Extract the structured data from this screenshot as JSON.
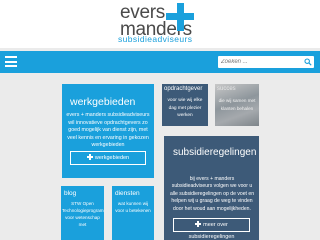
{
  "header": {
    "logo_line1": "evers",
    "logo_line2": "manders",
    "tagline": "subsidieadviseurs"
  },
  "nav": {
    "menu_icon": "hamburger-icon",
    "search_placeholder": "Zoeken ...",
    "search_icon": "search-icon"
  },
  "tiles": {
    "werkgebieden": {
      "title": "werkgebieden",
      "body": "evers + manders subsidieadviseurs wil innovatieve opdrachtgevers zo goed mogelijk van dienst zijn, met veel kennis en ervaring in gekozen werkgebieden",
      "button": "werkgebieden"
    },
    "opdrachtgever": {
      "title": "opdrachtgever",
      "body": "voor wie wij elke dag met plezier werken"
    },
    "photo": {
      "title": "succes",
      "body": "die wij samen met klanten behalen"
    },
    "subsidie": {
      "title": "subsidieregelingen",
      "body": "bij evers + manders subsidieadviseurs volgen we voor u alle subsidieregelingen op de voet en helpen wij u graag de weg te vinden door het woud aan mogelijkheden.",
      "button": "meer over subsidieregelingen"
    },
    "blog": {
      "title": "blog",
      "body": "STW Open Technologieprogramma voor wetenschap met"
    },
    "diensten": {
      "title": "diensten",
      "body": "wat kunnen wij voor u betekenen"
    }
  },
  "colors": {
    "brand_blue": "#1aa0dc",
    "dark_blue": "#3d5a78",
    "background": "#ebebeb"
  }
}
